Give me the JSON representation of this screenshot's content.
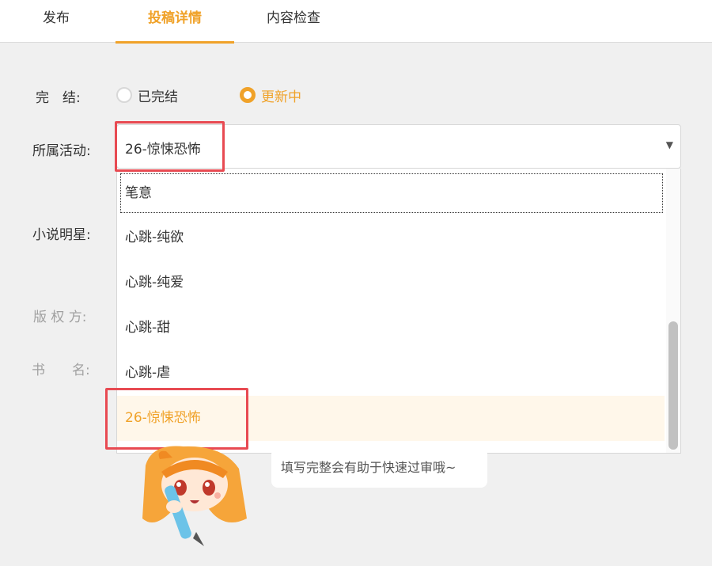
{
  "tabs": [
    {
      "label": "发布"
    },
    {
      "label": "投稿详情",
      "active": true
    },
    {
      "label": "内容检查"
    }
  ],
  "form": {
    "status_label": "完　结:",
    "status_options": [
      {
        "label": "已完结",
        "selected": false
      },
      {
        "label": "更新中",
        "selected": true
      }
    ],
    "activity_label": "所属活动:",
    "activity_value": "26-惊悚恐怖",
    "star_label": "小说明星:",
    "copyright_label": "版 权 方:",
    "book_label": "书　　名:"
  },
  "dropdown": {
    "options": [
      {
        "label": "笔意",
        "focused": true
      },
      {
        "label": "心跳-纯欲"
      },
      {
        "label": "心跳-纯爱"
      },
      {
        "label": "心跳-甜"
      },
      {
        "label": "心跳-虐"
      },
      {
        "label": "26-惊悚恐怖",
        "selected": true
      }
    ]
  },
  "hint": "填写完整会有助于快速过审哦~",
  "colors": {
    "accent": "#f0a229",
    "highlight": "#e84a52",
    "selected_bg": "#fff7ea"
  }
}
